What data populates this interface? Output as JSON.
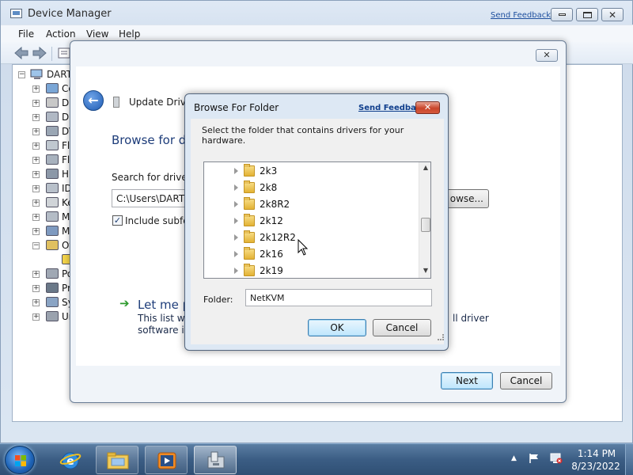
{
  "device_manager": {
    "title": "Device Manager",
    "send_feedback": "Send Feedback",
    "menu": [
      "File",
      "Action",
      "View",
      "Help"
    ],
    "tree_root": "DART",
    "tree_items": [
      {
        "label": "Co",
        "expander": "+"
      },
      {
        "label": "Di",
        "expander": "+"
      },
      {
        "label": "Di",
        "expander": "+"
      },
      {
        "label": "DV",
        "expander": "+"
      },
      {
        "label": "Fl",
        "expander": "+"
      },
      {
        "label": "Fl",
        "expander": "+"
      },
      {
        "label": "Hu",
        "expander": "+"
      },
      {
        "label": "ID",
        "expander": "+"
      },
      {
        "label": "Ke",
        "expander": "+"
      },
      {
        "label": "M",
        "expander": "+"
      },
      {
        "label": "M",
        "expander": "+"
      },
      {
        "label": "Ot",
        "expander": "−"
      },
      {
        "label": "",
        "expander": ""
      },
      {
        "label": "Po",
        "expander": "+"
      },
      {
        "label": "Pr",
        "expander": "+"
      },
      {
        "label": "Sy",
        "expander": "+"
      },
      {
        "label": "Ur",
        "expander": "+"
      }
    ]
  },
  "wizard": {
    "title": "Update Driver Software - Ethernet Controller",
    "heading": "Browse for dri",
    "search_label": "Search for driver so",
    "path_value": "C:\\Users\\DART\\D",
    "browse_label": "owse...",
    "include_subfolders": "Include subfold",
    "include_checked": "✓",
    "let_me_pick": "Let me pic",
    "list_line1": "This list will s",
    "list_line2": "software in t",
    "list_line1_right": "ll driver",
    "next_label": "Next",
    "cancel_label": "Cancel",
    "close_glyph": "✕",
    "back_glyph": "←",
    "arrow_glyph": "➔"
  },
  "browse_folder": {
    "title": "Browse For Folder",
    "send_feedback": "Send Feedback",
    "close_glyph": "✕",
    "instruction": "Select the folder that contains drivers for your hardware.",
    "folders": [
      "2k3",
      "2k8",
      "2k8R2",
      "2k12",
      "2k12R2",
      "2k16",
      "2k19"
    ],
    "folder_label": "Folder:",
    "folder_value": "NetKVM",
    "ok_label": "OK",
    "cancel_label": "Cancel",
    "scroll_up_glyph": "▲",
    "scroll_down_glyph": "▼"
  },
  "taskbar": {
    "time": "1:14 PM",
    "date": "8/23/2022",
    "tray_expand_glyph": "▲",
    "apps": [
      "internet-explorer",
      "windows-explorer",
      "media-player",
      "device-manager"
    ]
  }
}
